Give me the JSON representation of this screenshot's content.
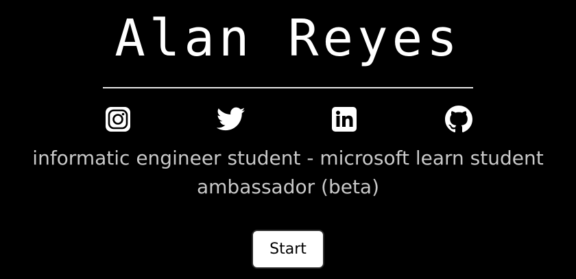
{
  "profile": {
    "name": "Alan Reyes",
    "tagline": "informatic engineer student - microsoft learn student ambassador (beta)"
  },
  "social": [
    {
      "icon": "instagram-icon"
    },
    {
      "icon": "twitter-icon"
    },
    {
      "icon": "linkedin-icon"
    },
    {
      "icon": "github-icon"
    }
  ],
  "cta": {
    "start_label": "Start"
  },
  "colors": {
    "background": "#000000",
    "title": "#ffffff",
    "tagline": "#c9c9c9",
    "button_bg": "#ffffff",
    "button_text": "#000000"
  }
}
